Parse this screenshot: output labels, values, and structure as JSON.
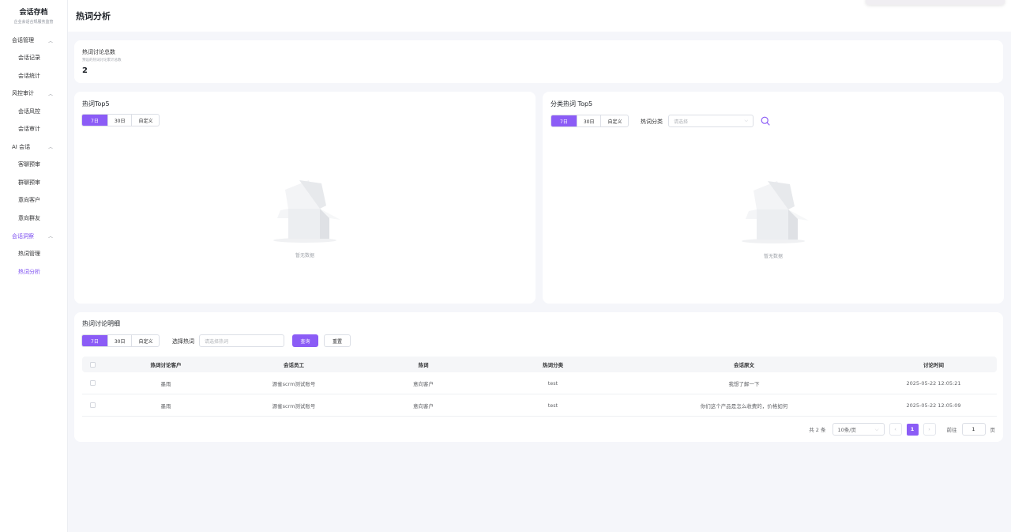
{
  "brand": {
    "title": "会话存档",
    "subtitle": "企业会话合规服务监管"
  },
  "sidebar": {
    "groups": [
      {
        "label": "会话管理",
        "items": [
          "会话记录",
          "会话统计"
        ]
      },
      {
        "label": "风控审计",
        "items": [
          "会话风控",
          "会话审计"
        ]
      },
      {
        "label": "AI 会话",
        "items": [
          "客聊预审",
          "群聊预审",
          "意向客户",
          "意向群友"
        ]
      },
      {
        "label": "会话洞察",
        "items": [
          "热词管理",
          "热词分析"
        ]
      }
    ],
    "active_group": "会话洞察",
    "active_item": "热词分析"
  },
  "header": {
    "title": "热词分析"
  },
  "summary": {
    "label": "热词讨论总数",
    "desc": "预设的热词讨论累计总数",
    "value": "2"
  },
  "top5": {
    "title": "热词Top5",
    "ranges": [
      "7日",
      "30日",
      "自定义"
    ],
    "active_range": "7日",
    "empty_text": "暂无数据"
  },
  "category_top5": {
    "title": "分类热词 Top5",
    "ranges": [
      "7日",
      "30日",
      "自定义"
    ],
    "active_range": "7日",
    "category_label": "热词分类",
    "category_placeholder": "请选择",
    "empty_text": "暂无数据"
  },
  "detail": {
    "title": "热词讨论明细",
    "ranges": [
      "7日",
      "30日",
      "自定义"
    ],
    "active_range": "7日",
    "select_label": "选择热词",
    "select_placeholder": "请选择热词",
    "query_label": "查询",
    "reset_label": "重置",
    "columns": [
      "热词讨论客户",
      "会话员工",
      "热词",
      "热词分类",
      "会话原文",
      "讨论时间"
    ],
    "rows": [
      [
        "墨雨",
        "源雀scrm测试账号",
        "意向客户",
        "test",
        "我想了解一下",
        "2025-05-22 12:05:21"
      ],
      [
        "墨雨",
        "源雀scrm测试账号",
        "意向客户",
        "test",
        "你们这个产品是怎么收费的，价格如何",
        "2025-05-22 12:05:09"
      ]
    ],
    "pagination": {
      "total_text": "共 2 条",
      "page_size": "10条/页",
      "current_page": "1",
      "goto_label": "前往",
      "goto_value": "1",
      "page_unit": "页"
    }
  },
  "colors": {
    "accent": "#8b5cf6",
    "active_text": "#7b4cf0"
  }
}
